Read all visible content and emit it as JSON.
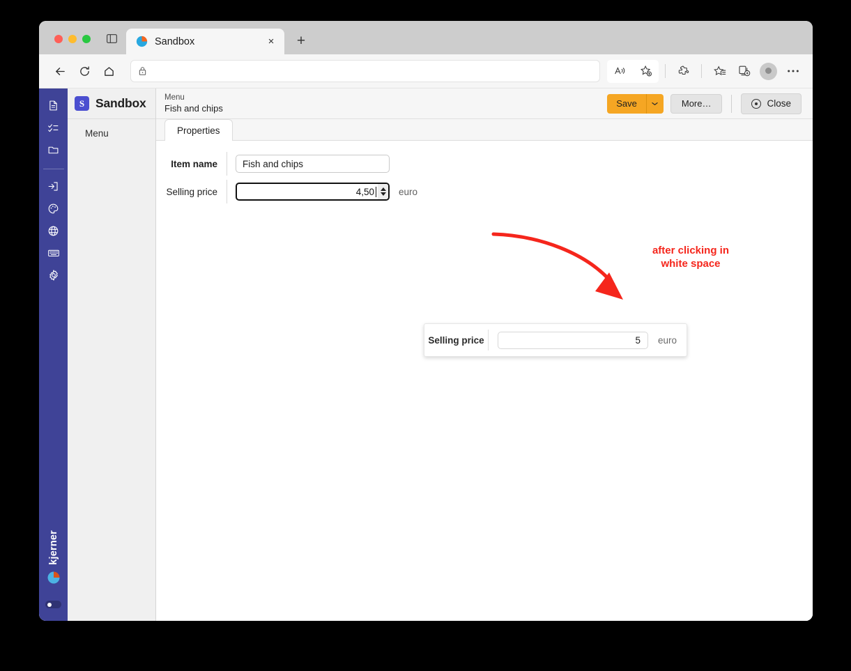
{
  "browser": {
    "tab": {
      "title": "Sandbox",
      "favicon": "pie-chart-favicon",
      "close_label": "×"
    },
    "new_tab_label": "+",
    "address": {
      "value": "",
      "placeholder": "",
      "lock_icon": "lock-icon"
    },
    "toolbar_icons": [
      "read-aloud-icon",
      "add-favorite-icon",
      "extensions-icon",
      "collections-icon",
      "split-screen-icon",
      "profile-avatar",
      "settings-more-icon"
    ],
    "nav_icons": [
      "back-icon",
      "reload-icon",
      "home-icon"
    ]
  },
  "rail": {
    "items": [
      {
        "icon": "document-icon",
        "label": "Document"
      },
      {
        "icon": "checklist-icon",
        "label": "Tasks"
      },
      {
        "icon": "folder-icon",
        "label": "Folder"
      },
      {
        "icon": "login-icon",
        "label": "Login"
      },
      {
        "icon": "palette-icon",
        "label": "Theme"
      },
      {
        "icon": "globe-icon",
        "label": "Language"
      },
      {
        "icon": "keyboard-icon",
        "label": "Keyboard"
      },
      {
        "icon": "gear-icon",
        "label": "Settings"
      }
    ],
    "brand": "kjerner",
    "logo_icon": "pie-chart-logo",
    "toggle_state": "off"
  },
  "menu_panel": {
    "brand_mark": "S",
    "brand_name": "Sandbox",
    "items": [
      {
        "label": "Menu"
      }
    ]
  },
  "header": {
    "breadcrumb_top": "Menu",
    "breadcrumb_main": "Fish and chips",
    "save_label": "Save",
    "save_dropdown_icon": "chevron-down-icon",
    "more_label": "More…",
    "close_label": "Close",
    "close_icon": "record-circle-icon"
  },
  "tabs": [
    {
      "label": "Properties",
      "active": true
    }
  ],
  "form": {
    "rows": [
      {
        "label": "Item name",
        "value": "Fish and chips",
        "unit": ""
      },
      {
        "label": "Selling price",
        "value": "4,50",
        "unit": "euro"
      }
    ]
  },
  "annotation": {
    "text_line1": "after clicking in",
    "text_line2": "white space",
    "color": "#f5261c",
    "arrow_icon": "curved-arrow-icon"
  },
  "popup": {
    "label": "Selling price",
    "value": "5",
    "unit": "euro"
  },
  "colors": {
    "rail_bg": "#3f4397",
    "brand_mark_bg": "#4b4fd0",
    "save_bg": "#f5a623",
    "annotation_red": "#f5261c",
    "panel_bg": "#f0f0f0"
  }
}
